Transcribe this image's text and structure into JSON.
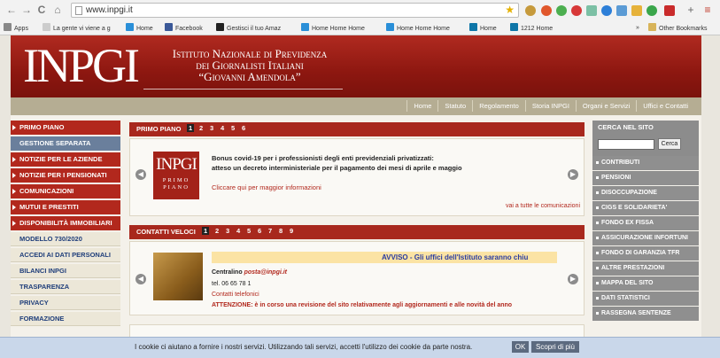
{
  "browser": {
    "nav": [
      "←",
      "→",
      "C",
      "⌂"
    ],
    "url": "www.inpgi.it",
    "bookmarks": [
      {
        "label": "Apps",
        "color": "#888"
      },
      {
        "label": "La gente vi viene a g",
        "color": "#bbb"
      },
      {
        "label": "Home",
        "color": "#2a8fd8"
      },
      {
        "label": "Facebook",
        "color": "#3b5998"
      },
      {
        "label": "Gestisci il tuo Amaz",
        "color": "#222"
      },
      {
        "label": "Home Home Home",
        "color": "#2a8fd8"
      },
      {
        "label": "Home Home Home",
        "color": "#2a8fd8"
      },
      {
        "label": "Home",
        "color": "#0e76a8"
      },
      {
        "label": "1212 Home",
        "color": "#0e76a8"
      },
      {
        "label": "Other Bookmarks",
        "color": "#d8b45a"
      }
    ],
    "overflow": "»"
  },
  "header": {
    "logo": "INPGI",
    "inst_line1": "Istituto Nazionale di Previdenza",
    "inst_line2": "dei Giornalisti Italiani",
    "inst_line3": "“Giovanni Amendola”",
    "topnav": [
      "Home",
      "Statuto",
      "Regolamento",
      "Storia INPGI",
      "Organi e Servizi",
      "Uffici e Contatti"
    ]
  },
  "left_nav": [
    {
      "label": "PRIMO PIANO",
      "style": "red"
    },
    {
      "label": "GESTIONE SEPARATA",
      "style": "active"
    },
    {
      "label": "NOTIZIE PER LE AZIENDE",
      "style": "red"
    },
    {
      "label": "NOTIZIE PER I PENSIONATI",
      "style": "red"
    },
    {
      "label": "COMUNICAZIONI",
      "style": "red"
    },
    {
      "label": "MUTUI E PRESTITI",
      "style": "red"
    },
    {
      "label": "DISPONIBILITÀ IMMOBILIARI",
      "style": "red"
    },
    {
      "label": "MODELLO 730/2020",
      "style": "light"
    },
    {
      "label": "ACCEDI AI DATI PERSONALI",
      "style": "light"
    },
    {
      "label": "BILANCI INPGI",
      "style": "light"
    },
    {
      "label": "TRASPARENZA",
      "style": "light"
    },
    {
      "label": "PRIVACY",
      "style": "light"
    },
    {
      "label": "FORMAZIONE",
      "style": "light"
    }
  ],
  "primo_piano": {
    "title": "PRIMO PIANO",
    "pages": [
      "1",
      "2",
      "3",
      "4",
      "5",
      "6"
    ],
    "thumb_logo": "INPGI",
    "thumb_caption": "PRIMO PIANO",
    "news_line1": "Bonus covid-19 per i professionisti degli enti previdenziali privatizzati:",
    "news_line2": "atteso un decreto interministeriale per il pagamento dei mesi di aprile e maggio",
    "more_link": "Cliccare qui per maggior informazioni",
    "all_link": "vai a tutte le comunicazioni"
  },
  "contatti": {
    "title": "CONTATTI VELOCI",
    "pages": [
      "1",
      "2",
      "3",
      "4",
      "5",
      "6",
      "7",
      "8",
      "9"
    ],
    "ticker": "AVVISO - Gli uffici dell'Istituto saranno chiu",
    "centralino_label": "Centralino",
    "centralino_email": "posta@inpgi.it",
    "tel": "tel. 06 65 78 1",
    "tel_link": "Contatti telefonici",
    "attention": "ATTENZIONE: è in corso una revisione del sito relativamente agli aggiornamenti e alle novità del anno"
  },
  "right_col": {
    "search_title": "CERCA NEL SITO",
    "search_button": "Cerca",
    "items": [
      "CONTRIBUTI",
      "PENSIONI",
      "DISOCCUPAZIONE",
      "CIGS E SOLIDARIETA'",
      "FONDO EX FISSA",
      "ASSICURAZIONE INFORTUNI",
      "FONDO DI GARANZIA TFR",
      "ALTRE PRESTAZIONI",
      "MAPPA DEL SITO",
      "DATI STATISTICI",
      "RASSEGNA SENTENZE"
    ]
  },
  "cookie": {
    "message": "I cookie ci aiutano a fornire i nostri servizi. Utilizzando tali servizi, accetti l'utilizzo dei cookie da parte nostra.",
    "ok": "OK",
    "more": "Scopri di più"
  }
}
